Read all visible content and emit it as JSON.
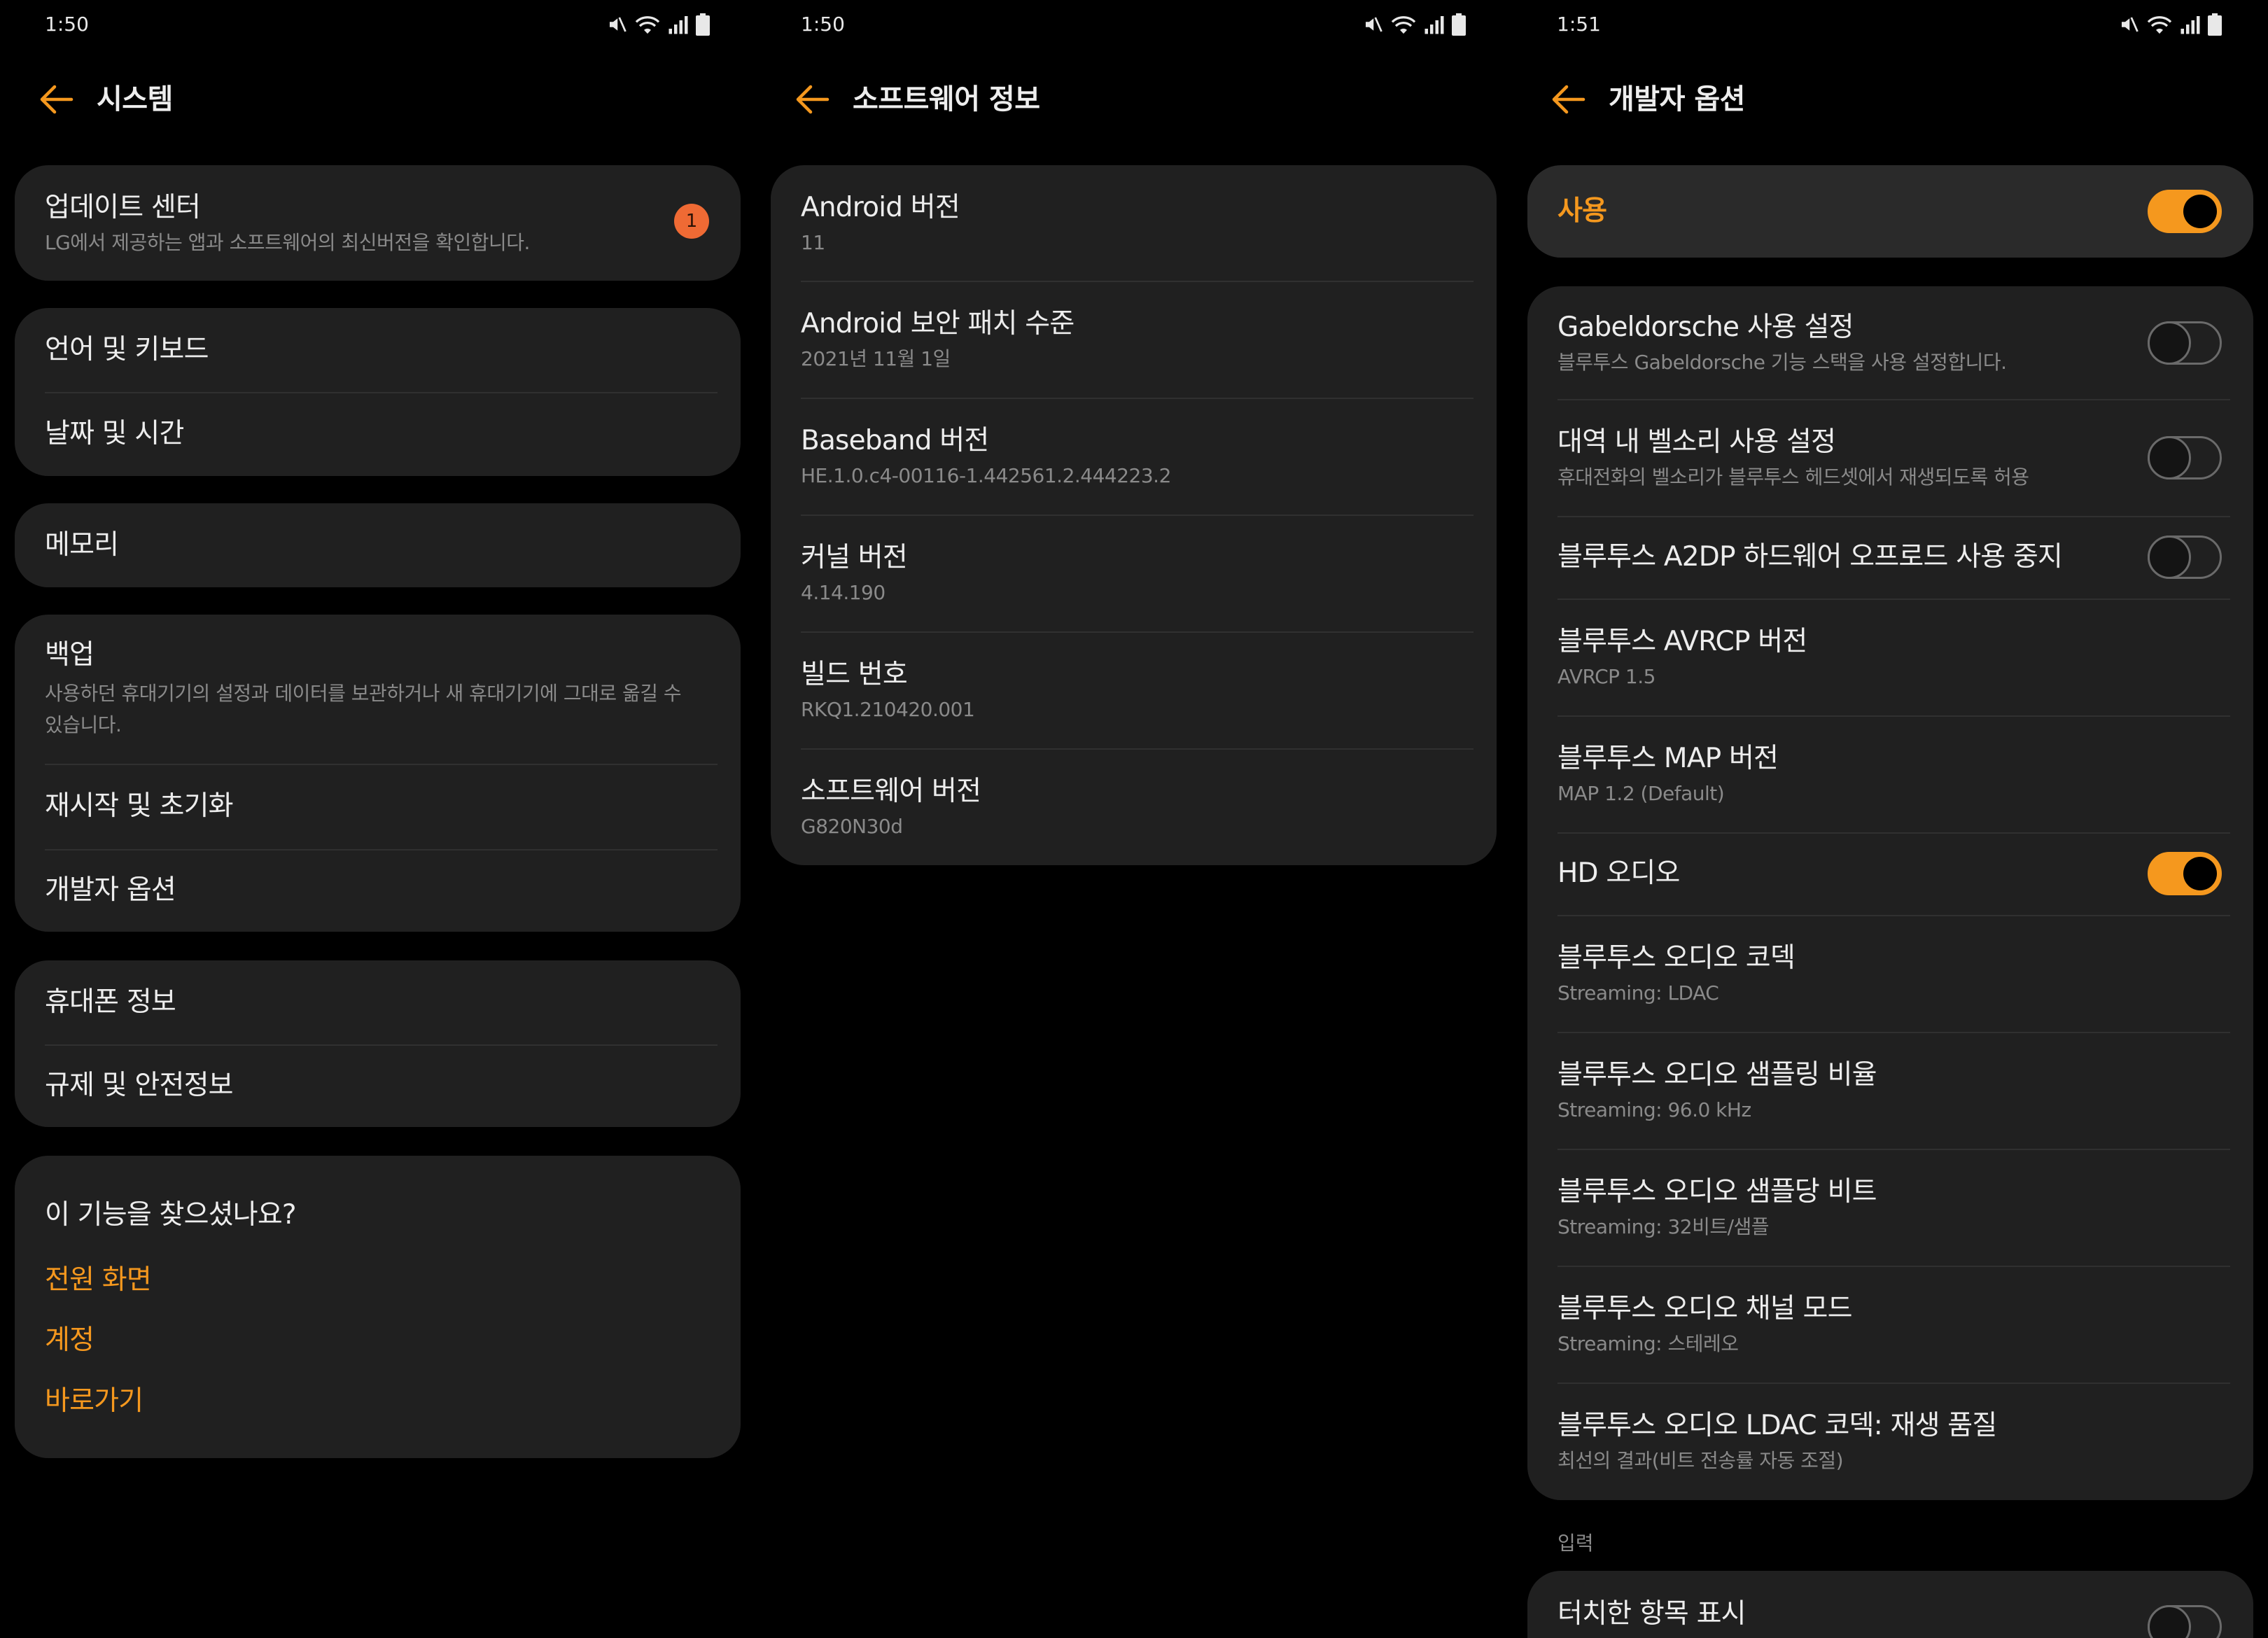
{
  "colors": {
    "accent": "#F5981E",
    "badge": "#EF6A34",
    "background": "#000000",
    "card": "#202020",
    "card_highlight": "#2A2A2A",
    "text": "#EDEDED",
    "subtext": "#8A8A8A",
    "divider": "#303030",
    "toggle_off": "#6A6A6A"
  },
  "icons": {
    "back": "arrow-left-icon",
    "mute": "volume-mute-icon",
    "wifi": "wifi-icon",
    "signal": "cell-signal-icon",
    "battery": "battery-icon"
  },
  "system": {
    "status_time": "1:50",
    "title": "시스템",
    "update_center": {
      "label": "업데이트 센터",
      "summary": "LG에서 제공하는 앱과 소프트웨어의 최신버전을 확인합니다.",
      "badge": "1"
    },
    "language_keyboard": "언어 및 키보드",
    "date_time": "날짜 및 시간",
    "memory": "메모리",
    "backup": {
      "label": "백업",
      "summary_lines": [
        "사용하던 휴대기기의 설정과 데이터를 보관하거나 새 휴대기기에 그대로 옮길 수",
        "있습니다."
      ]
    },
    "restart_reset": "재시작 및 초기화",
    "developer_options": "개발자 옵션",
    "phone_info": "휴대폰 정보",
    "regulatory_safety": "규제 및 안전정보",
    "suggestions": {
      "heading": "이 기능을 찾으셨나요?",
      "links": [
        "전원 화면",
        "계정",
        "바로가기"
      ]
    }
  },
  "software_info": {
    "status_time": "1:50",
    "title": "소프트웨어 정보",
    "items": [
      {
        "label": "Android 버전",
        "value": "11"
      },
      {
        "label": "Android 보안 패치 수준",
        "value": "2021년 11월 1일"
      },
      {
        "label": "Baseband 버전",
        "value": "HE.1.0.c4-00116-1.442561.2.444223.2"
      },
      {
        "label": "커널 버전",
        "value": "4.14.190"
      },
      {
        "label": "빌드 번호",
        "value": "RKQ1.210420.001"
      },
      {
        "label": "소프트웨어 버전",
        "value": "G820N30d"
      }
    ]
  },
  "developer": {
    "status_time": "1:51",
    "title": "개발자 옵션",
    "master": {
      "label": "사용",
      "enabled": true
    },
    "items": [
      {
        "label": "Gabeldorsche 사용 설정",
        "summary": "블루투스 Gabeldorsche 기능 스택을 사용 설정합니다.",
        "toggle": false
      },
      {
        "label": "대역 내 벨소리 사용 설정",
        "summary": "휴대전화의 벨소리가 블루투스 헤드셋에서 재생되도록 허용",
        "toggle": false
      },
      {
        "label": "블루투스 A2DP 하드웨어 오프로드 사용 중지",
        "toggle": false
      },
      {
        "label": "블루투스 AVRCP 버전",
        "summary": "AVRCP 1.5"
      },
      {
        "label": "블루투스 MAP 버전",
        "summary": "MAP 1.2 (Default)"
      },
      {
        "label": "HD 오디오",
        "toggle": true
      },
      {
        "label": "블루투스 오디오 코덱",
        "summary": "Streaming: LDAC"
      },
      {
        "label": "블루투스 오디오 샘플링 비율",
        "summary": "Streaming: 96.0 kHz"
      },
      {
        "label": "블루투스 오디오 샘플당 비트",
        "summary": "Streaming: 32비트/샘플"
      },
      {
        "label": "블루투스 오디오 채널 모드",
        "summary": "Streaming: 스테레오"
      },
      {
        "label": "블루투스 오디오 LDAC 코덱: 재생 품질",
        "summary": "최선의 결과(비트 전송률 자동 조절)"
      }
    ],
    "section_input": "입력",
    "show_taps": {
      "label": "터치한 항목 표시",
      "enabled": false
    }
  }
}
